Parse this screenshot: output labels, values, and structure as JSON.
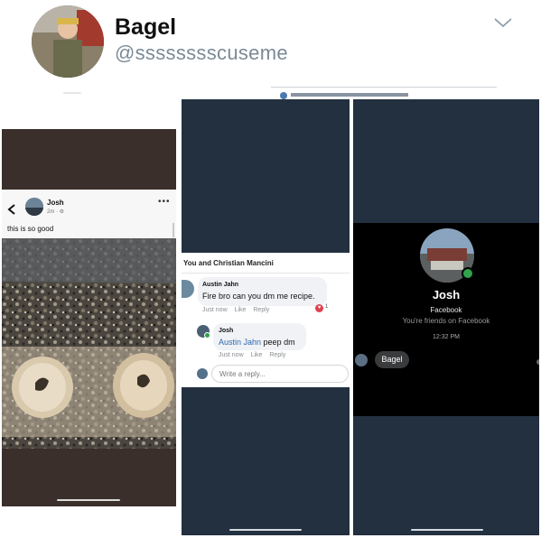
{
  "profile": {
    "display_name": "Bagel",
    "handle": "@sssssssscuseme",
    "chevron_icon": "chevron-down-icon"
  },
  "screenshot1": {
    "back_icon": "chevron-left-icon",
    "author": "Josh",
    "time": "2m · ⚙",
    "more_icon": "ellipsis-icon",
    "post_text": "this is so good",
    "photo": "two-bagel-halves-on-counter"
  },
  "screenshot2": {
    "conversation_title": "You and Christian Mancini",
    "comment1": {
      "author": "Austin Jahn",
      "text": "Fire bro can you dm me recipe.",
      "time": "Just now",
      "like": "Like",
      "reply": "Reply",
      "reaction_count": "1"
    },
    "comment2": {
      "author": "Josh",
      "mention": "Austin Jahn",
      "text": "peep dm",
      "time": "Just now",
      "like": "Like",
      "reply": "Reply"
    },
    "reply_placeholder": "Write a reply..."
  },
  "screenshot3": {
    "name": "Josh",
    "platform": "Facebook",
    "friend_status": "You're friends on Facebook",
    "time": "12:32 PM",
    "message": "Bagel"
  },
  "colors": {
    "dark_panel": "#22303f",
    "facebook_link": "#2d6ab4",
    "online_green": "#31a24c"
  }
}
